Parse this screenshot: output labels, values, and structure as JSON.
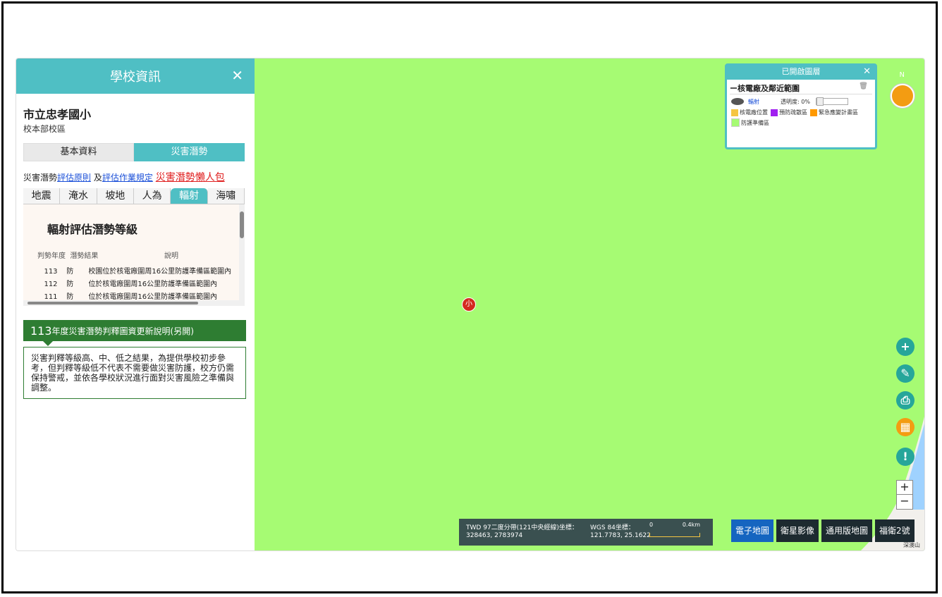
{
  "panel": {
    "title": "學校資訊",
    "close": "✕",
    "school_name": "市立忠孝國小",
    "campus": "校本部校區",
    "tabs": [
      "基本資料",
      "災害潛勢"
    ],
    "links": {
      "prefix": "災害潛勢",
      "principle": "評估原則",
      "and": "及",
      "rules": "評估作業規定",
      "pack": "災害潛勢懶人包"
    },
    "hazard_tabs": [
      "地震",
      "淹水",
      "坡地",
      "人為",
      "輻射",
      "海嘯"
    ],
    "section_title": "輻射評估潛勢等級",
    "table": {
      "headers": [
        "判勢年度",
        "潛勢結果",
        "說明"
      ],
      "rows": [
        [
          "113",
          "防",
          "校園位於核電廠圍周16公里防護準備區範圍內"
        ],
        [
          "112",
          "防",
          "位於核電廠圍周16公里防護準備區範圍內"
        ],
        [
          "111",
          "防",
          "位於核電廠圍周16公里防護準備區範圍內"
        ]
      ]
    },
    "notice_year": "113",
    "notice_title": "年度災害潛勢判釋圖資更新說明(另開)",
    "notice_text": "災害判釋等級高、中、低之結果，為提供學校初步參考，但判釋等級低不代表不需要做災害防護，校方仍需保持警戒，並依各學校狀況進行面對災害風險之準備與調整。"
  },
  "map": {
    "marker_label": "小",
    "layers": {
      "title": "已開啟圖層",
      "close": "✕",
      "layer_name": "ー核電廠及鄰近範圍",
      "trash_icon": "🗑",
      "layer_type": "輻射",
      "opacity_label": "透明度: 0%",
      "legend": [
        {
          "label": "核電廠位置",
          "color": "#f5c542"
        },
        {
          "label": "預防疏散區",
          "color": "#a020f0"
        },
        {
          "label": "緊急應變計畫區",
          "color": "#ff9900"
        },
        {
          "label": "防護準備區",
          "color": "#a6fb73"
        }
      ]
    },
    "compass_n": "N",
    "tools": [
      "+",
      "✎",
      "⎙",
      "▦",
      "!"
    ],
    "zoom_in": "+",
    "zoom_out": "−",
    "coord": {
      "twd_label": "TWD 97二度分帶(121中央經線)坐標：",
      "twd_value": "328463, 2783974",
      "wgs_label": "WGS 84坐標：",
      "wgs_value": "121.7783, 25.1622",
      "scale_start": "0",
      "scale_end": "0.4km"
    },
    "basemaps": [
      "電子地圖",
      "衛星影像",
      "通用版地圖",
      "福衛2號"
    ],
    "place_label": "深澳山"
  }
}
